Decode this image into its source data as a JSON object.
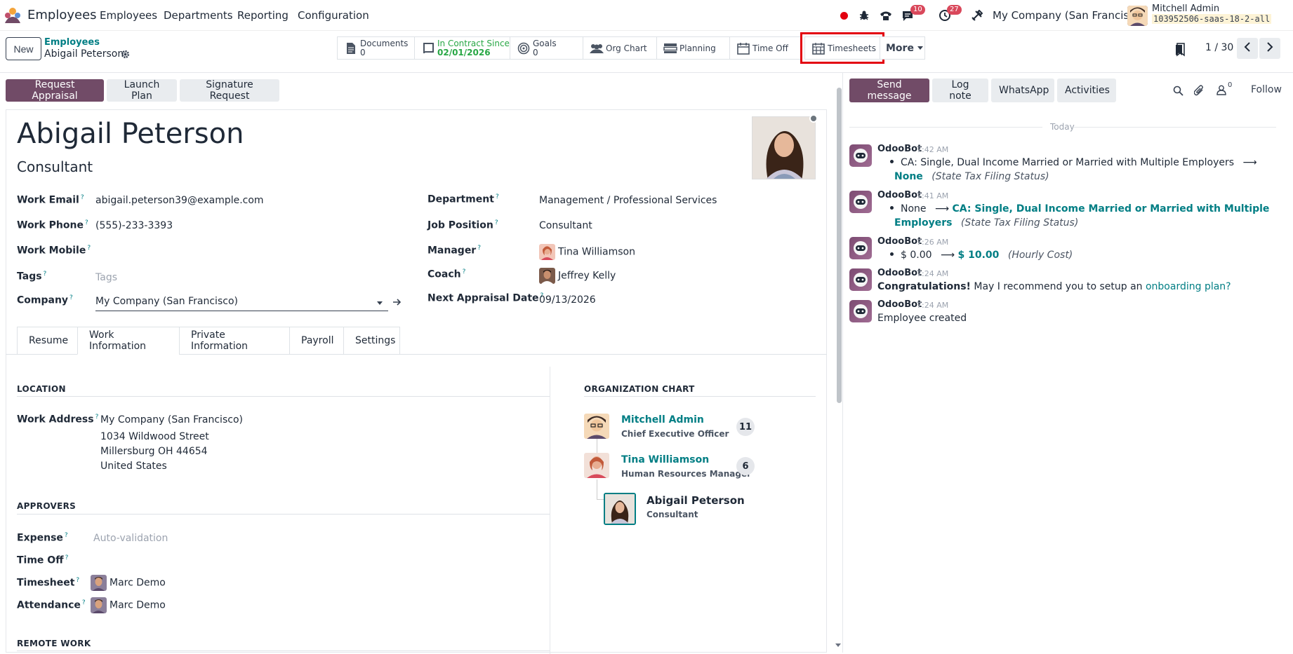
{
  "topbar": {
    "app_name": "Employees",
    "menu": [
      "Employees",
      "Departments",
      "Reporting",
      "Configuration"
    ],
    "messages_count": "10",
    "activities_count": "27",
    "company": "My Company (San Francisco)",
    "user_name": "Mitchell Admin",
    "database": "103952506-saas-18-2-all"
  },
  "control": {
    "new_label": "New",
    "breadcrumb_parent": "Employees",
    "breadcrumb_current": "Abigail Peterson",
    "smart_buttons": {
      "documents_label": "Documents",
      "documents_count": "0",
      "contract_label": "In Contract Since",
      "contract_date": "02/01/2026",
      "goals_label": "Goals",
      "goals_count": "0",
      "org_chart_label": "Org Chart",
      "planning_label": "Planning",
      "time_off_label": "Time Off",
      "timesheets_label": "Timesheets",
      "more_label": "More"
    },
    "pager": "1 / 30"
  },
  "actions": {
    "request_appraisal": "Request Appraisal",
    "launch_plan": "Launch Plan",
    "signature_request": "Signature Request"
  },
  "employee": {
    "name": "Abigail Peterson",
    "job_title": "Consultant",
    "fields": {
      "work_email_label": "Work Email",
      "work_email": "abigail.peterson39@example.com",
      "work_phone_label": "Work Phone",
      "work_phone": "(555)-233-3393",
      "work_mobile_label": "Work Mobile",
      "tags_label": "Tags",
      "tags_placeholder": "Tags",
      "company_label": "Company",
      "company": "My Company (San Francisco)",
      "department_label": "Department",
      "department": "Management / Professional Services",
      "job_position_label": "Job Position",
      "job_position": "Consultant",
      "manager_label": "Manager",
      "manager": "Tina Williamson",
      "coach_label": "Coach",
      "coach": "Jeffrey Kelly",
      "next_appraisal_label": "Next Appraisal Date",
      "next_appraisal": "09/13/2026"
    }
  },
  "tabs": [
    "Resume",
    "Work Information",
    "Private Information",
    "Payroll",
    "Settings"
  ],
  "work_info": {
    "location_title": "LOCATION",
    "work_address_label": "Work Address",
    "address_lines": [
      "My Company (San Francisco)",
      "1034 Wildwood Street",
      "Millersburg OH 44654",
      "United States"
    ],
    "approvers_title": "APPROVERS",
    "expense_label": "Expense",
    "expense_value": "Auto-validation",
    "time_off_label": "Time Off",
    "timesheet_label": "Timesheet",
    "timesheet_value": "Marc Demo",
    "attendance_label": "Attendance",
    "attendance_value": "Marc Demo",
    "remote_title": "REMOTE WORK"
  },
  "org_chart": {
    "title": "ORGANIZATION CHART",
    "nodes": [
      {
        "name": "Mitchell Admin",
        "title": "Chief Executive Officer",
        "count": "11"
      },
      {
        "name": "Tina Williamson",
        "title": "Human Resources Manager",
        "count": "6"
      },
      {
        "name": "Abigail Peterson",
        "title": "Consultant"
      }
    ]
  },
  "chatter": {
    "send_message": "Send message",
    "log_note": "Log note",
    "whatsapp": "WhatsApp",
    "activities": "Activities",
    "followers_count": "0",
    "follow": "Follow",
    "today": "Today",
    "messages": [
      {
        "author": "OdooBot",
        "time": "7:42 AM",
        "old": "CA: Single, Dual Income Married or Married with Multiple Employers",
        "new": "None",
        "field": "(State Tax Filing Status)"
      },
      {
        "author": "OdooBot",
        "time": "7:41 AM",
        "old": "None",
        "new_line1": "CA: Single, Dual Income Married or Married with Multiple",
        "new_line2": "Employers",
        "field": "(State Tax Filing Status)"
      },
      {
        "author": "OdooBot",
        "time": "7:26 AM",
        "old": "$ 0.00",
        "new": "$ 10.00",
        "field": "(Hourly Cost)"
      },
      {
        "author": "OdooBot",
        "time": "7:24 AM",
        "bold": "Congratulations!",
        "text": "May I recommend you to setup an",
        "link": "onboarding plan?"
      },
      {
        "author": "OdooBot",
        "time": "7:24 AM",
        "text": "Employee created"
      }
    ]
  }
}
